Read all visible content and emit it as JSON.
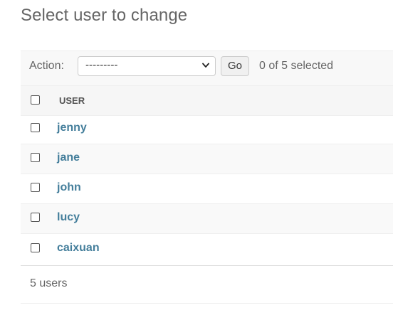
{
  "page": {
    "title": "Select user to change"
  },
  "actions": {
    "label": "Action:",
    "selected_option": "---------",
    "go_label": "Go",
    "selection_counter": "0 of 5 selected"
  },
  "table": {
    "column_header": "USER",
    "rows": [
      {
        "username": "jenny"
      },
      {
        "username": "jane"
      },
      {
        "username": "john"
      },
      {
        "username": "lucy"
      },
      {
        "username": "caixuan"
      }
    ]
  },
  "footer": {
    "count_text": "5 users"
  },
  "colors": {
    "link": "#447e9b",
    "header_bg": "#f6f6f6",
    "alt_row_bg": "#f9f9f9"
  },
  "icons": {
    "select_arrow": "chevron-down-icon"
  }
}
